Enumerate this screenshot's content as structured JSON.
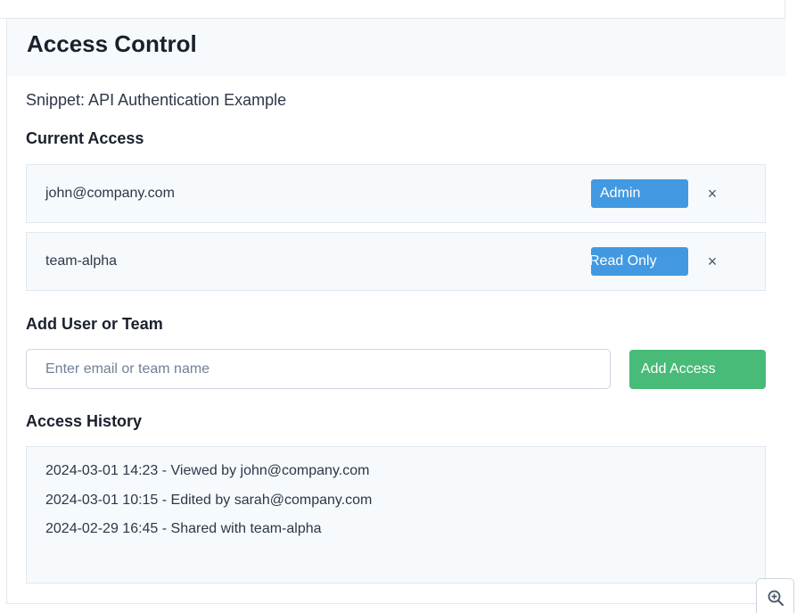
{
  "header": {
    "title": "Access Control"
  },
  "snippet": {
    "label": "Snippet: API Authentication Example"
  },
  "current_access": {
    "heading": "Current Access",
    "entries": [
      {
        "name": "john@company.com",
        "role": "Admin",
        "remove": "×"
      },
      {
        "name": "team-alpha",
        "role": "Read Only",
        "remove": "×"
      }
    ]
  },
  "add_section": {
    "heading": "Add User or Team",
    "input_placeholder": "Enter email or team name",
    "input_value": "",
    "button_label": "Add Access"
  },
  "history": {
    "heading": "Access History",
    "items": [
      "2024-03-01 14:23 - Viewed by john@company.com",
      "2024-03-01 10:15 - Edited by sarah@company.com",
      "2024-02-29 16:45 - Shared with team-alpha"
    ]
  },
  "icons": {
    "remove": "close-icon",
    "zoom": "zoom-in-icon"
  },
  "colors": {
    "role_badge": "#4299e1",
    "add_button": "#48bb78",
    "panel_bg": "#f7fafc"
  }
}
